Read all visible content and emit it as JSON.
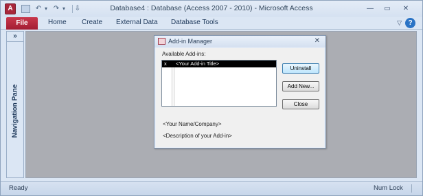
{
  "titlebar": {
    "title": "Database4 : Database (Access 2007 - 2010)  -  Microsoft Access",
    "app_icon": "A",
    "qat": {
      "undo": "↶",
      "undo_arrow": "▾",
      "redo": "↷",
      "redo_arrow": "▾",
      "customize": "⇩"
    },
    "controls": {
      "minimize": "—",
      "restore": "▭",
      "close": "✕"
    }
  },
  "ribbon": {
    "file": "File",
    "tabs": [
      "Home",
      "Create",
      "External Data",
      "Database Tools"
    ],
    "minimize_ribbon": "▽",
    "help": "?"
  },
  "navpane": {
    "chevron": "»",
    "label": "Navigation Pane"
  },
  "dialog": {
    "title": "Add-in Manager",
    "close": "✕",
    "available_label": "Available Add-ins:",
    "list": [
      {
        "marker": "x",
        "title": "<Your Add-in Title>"
      }
    ],
    "buttons": {
      "uninstall": "Uninstall",
      "add_new": "Add New...",
      "close": "Close"
    },
    "company": "<Your Name/Company>",
    "description": "<Description of your Add-in>"
  },
  "statusbar": {
    "left": "Ready",
    "right": "Num Lock"
  },
  "colors": {
    "file_tab": "#b72b40",
    "workspace": "#abadb3",
    "window_bg": "#dbe6f4",
    "help": "#2a73c5"
  }
}
